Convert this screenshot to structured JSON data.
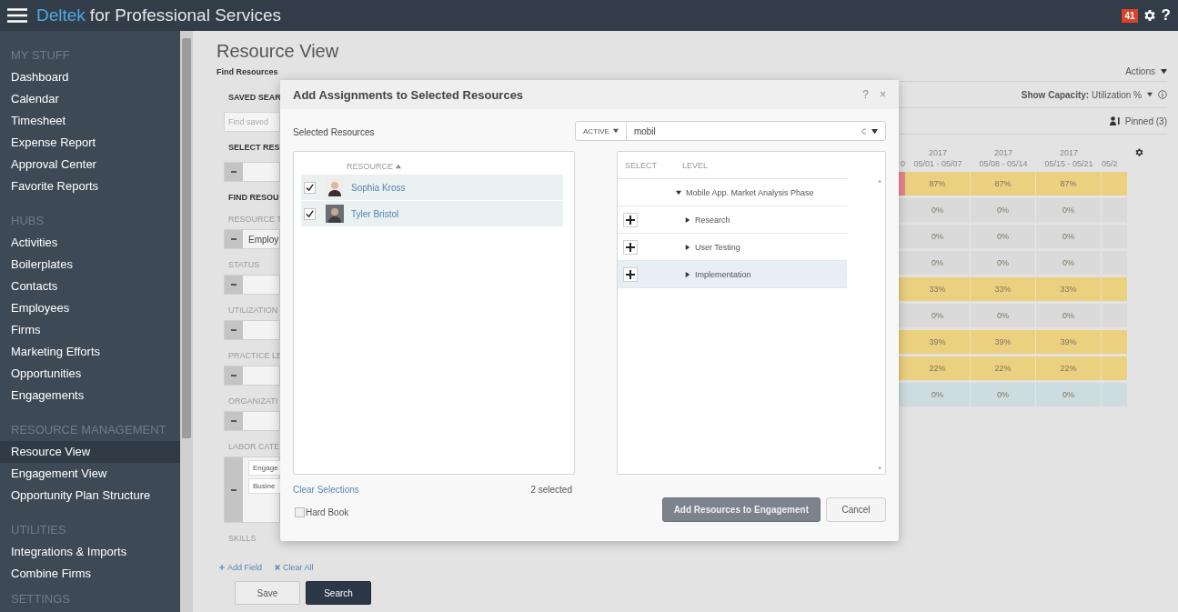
{
  "app": {
    "brand": "Deltek",
    "title": "for Professional Services",
    "notifications": "41",
    "help": "?"
  },
  "sidebar": {
    "sections": [
      {
        "heading": "MY STUFF",
        "items": [
          {
            "label": "Dashboard",
            "selected": false
          },
          {
            "label": "Calendar",
            "selected": false
          },
          {
            "label": "Timesheet",
            "selected": false
          },
          {
            "label": "Expense Report",
            "selected": false
          },
          {
            "label": "Approval Center",
            "selected": false
          },
          {
            "label": "Favorite Reports",
            "selected": false
          }
        ]
      },
      {
        "heading": "HUBS",
        "items": [
          {
            "label": "Activities",
            "selected": false
          },
          {
            "label": "Boilerplates",
            "selected": false
          },
          {
            "label": "Contacts",
            "selected": false
          },
          {
            "label": "Employees",
            "selected": false
          },
          {
            "label": "Firms",
            "selected": false
          },
          {
            "label": "Marketing Efforts",
            "selected": false
          },
          {
            "label": "Opportunities",
            "selected": false
          },
          {
            "label": "Engagements",
            "selected": false
          }
        ]
      },
      {
        "heading": "RESOURCE MANAGEMENT",
        "items": [
          {
            "label": "Resource View",
            "selected": true
          },
          {
            "label": "Engagement View",
            "selected": false
          },
          {
            "label": "Opportunity Plan Structure",
            "selected": false
          }
        ]
      },
      {
        "heading": "UTILITIES",
        "items": [
          {
            "label": "Integrations & Imports",
            "selected": false
          },
          {
            "label": "Combine Firms",
            "selected": false
          }
        ]
      },
      {
        "heading": "SETTINGS"
      }
    ]
  },
  "page": {
    "title": "Resource View"
  },
  "filters": {
    "title": "Find Resources",
    "fields": [
      {
        "kind": "search",
        "label": "SAVED SEAR",
        "bold": true,
        "placeholder": "Find saved"
      },
      {
        "kind": "select",
        "label": "SELECT RES",
        "bold": true
      },
      {
        "kind": "heading",
        "label": "FIND RESOU"
      },
      {
        "kind": "select",
        "label": "RESOURCE T",
        "bold": false,
        "values": [
          "Employ"
        ]
      },
      {
        "kind": "select",
        "label": "STATUS",
        "bold": false
      },
      {
        "kind": "select",
        "label": "UTILIZATION",
        "bold": false
      },
      {
        "kind": "select",
        "label": "PRACTICE LE",
        "bold": false
      },
      {
        "kind": "select",
        "label": "ORGANIZATI",
        "bold": false
      },
      {
        "kind": "multi",
        "label": "LABOR CATE",
        "bold": false,
        "values": [
          "Engage",
          "Busine"
        ]
      },
      {
        "kind": "label",
        "label": "SKILLS",
        "bold": false
      }
    ],
    "links": [
      {
        "kind": "add",
        "label": "Add Field"
      },
      {
        "kind": "clear",
        "label": "Clear All"
      }
    ],
    "buttons": [
      {
        "label": "Save",
        "kind": "secondary"
      },
      {
        "label": "Search",
        "kind": "primary"
      }
    ]
  },
  "grid": {
    "actions": "Actions",
    "capacity": "**Show Capacity:** Utilization %",
    "pinned": "Pinned (3)",
    "columns": [
      {
        "kind": "partial",
        "range": "0"
      },
      {
        "kind": "full",
        "year": "2017",
        "range": "05/01 - 05/07"
      },
      {
        "kind": "full",
        "year": "2017",
        "range": "05/08 - 05/14"
      },
      {
        "kind": "full",
        "year": "2017",
        "range": "05/15 - 05/21"
      },
      {
        "kind": "partial",
        "range": "05/2"
      }
    ],
    "rows": [
      {
        "color": "#ead07f",
        "alert": true,
        "values": [
          "87%",
          "87%",
          "87%"
        ]
      },
      {
        "color": "#dadada",
        "alert": false,
        "values": [
          "0%",
          "0%",
          "0%"
        ]
      },
      {
        "color": "#dadada",
        "alert": false,
        "values": [
          "0%",
          "0%",
          "0%"
        ]
      },
      {
        "color": "#dadada",
        "alert": false,
        "values": [
          "0%",
          "0%",
          "0%"
        ]
      },
      {
        "color": "#ead07f",
        "alert": false,
        "values": [
          "33%",
          "33%",
          "33%"
        ]
      },
      {
        "color": "#dadada",
        "alert": false,
        "values": [
          "0%",
          "0%",
          "0%"
        ]
      },
      {
        "color": "#ead07f",
        "alert": false,
        "values": [
          "39%",
          "39%",
          "39%"
        ]
      },
      {
        "color": "#ead07f",
        "alert": false,
        "values": [
          "22%",
          "22%",
          "22%"
        ]
      },
      {
        "color": "#cddcdf",
        "alert": false,
        "values": [
          "0%",
          "0%",
          "0%"
        ]
      }
    ]
  },
  "dialog": {
    "title": "Add Assignments to Selected Resources",
    "help": "?",
    "close": "×",
    "selected_label": "Selected Resources",
    "filter": {
      "status": "ACTIVE",
      "value": "mobil"
    },
    "resources": {
      "column": "RESOURCE",
      "items": [
        {
          "name": "Sophia Kross",
          "checked": true
        },
        {
          "name": "Tyler Bristol",
          "checked": true
        }
      ]
    },
    "clear": "Clear Selections",
    "count": "2 selected",
    "hard_book": {
      "label": "Hard Book",
      "checked": false
    },
    "tree": {
      "columns": [
        "SELECT",
        "LEVEL"
      ],
      "items": [
        {
          "label": "Mobile App. Market Analysis Phase",
          "expanded": true,
          "selected": false,
          "addable": false,
          "children": [
            {
              "label": "Research",
              "expanded": false,
              "selected": false,
              "addable": true
            },
            {
              "label": "User Testing",
              "expanded": false,
              "selected": false,
              "addable": true
            },
            {
              "label": "Implementation",
              "expanded": false,
              "selected": true,
              "addable": true
            }
          ]
        }
      ]
    },
    "buttons": [
      {
        "label": "Add Resources to Engagement",
        "kind": "primary",
        "disabled": true
      },
      {
        "label": "Cancel",
        "kind": "secondary",
        "disabled": false
      }
    ]
  }
}
